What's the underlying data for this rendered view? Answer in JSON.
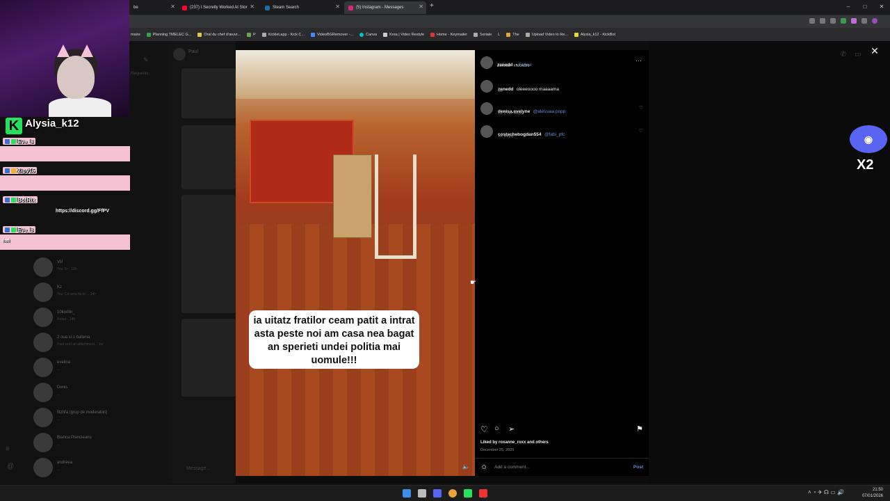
{
  "tabs": [
    {
      "label": "be",
      "color": "#888"
    },
    {
      "label": "(237) I Secretly Worked At Stor",
      "color": "#ff0033"
    },
    {
      "label": "Steam Search",
      "color": "#1b6ea8"
    },
    {
      "label": "(5) Instagram - Messages",
      "color": "#d62976"
    }
  ],
  "bookmarks": [
    {
      "label": "maire",
      "color": "#777"
    },
    {
      "label": "Planning TMELEC G...",
      "color": "#2ea44f"
    },
    {
      "label": "Oral du chef d'œuvr...",
      "color": "#e8c547"
    },
    {
      "label": "P",
      "color": "#6aa84f"
    },
    {
      "label": "Kicklet.app - Kick C...",
      "color": "#aaa"
    },
    {
      "label": "VideoBGRemover -...",
      "color": "#3f8cff"
    },
    {
      "label": "Canva",
      "color": "#00c4cc"
    },
    {
      "label": "Krea | Video Restyle",
      "color": "#ccc"
    },
    {
      "label": "Home - Keymailer",
      "color": "#d33"
    },
    {
      "label": "Seriale",
      "color": "#aaa"
    },
    {
      "label": "L",
      "color": "#aaa"
    },
    {
      "label": "The",
      "color": "#e5a43a"
    },
    {
      "label": "Upload Video to Re...",
      "color": "#aaa"
    },
    {
      "label": "Alysia_k12 - KickBot",
      "color": "#e8d83a"
    }
  ],
  "streamer": {
    "name": "Alysia_k12",
    "badge": "K"
  },
  "chat": [
    {
      "user": "Eve_8",
      "text": ""
    },
    {
      "user": "Zipy15",
      "text": ""
    },
    {
      "user": "BotRix",
      "text": "https://discord.gg/FfPV"
    },
    {
      "user": "Eve_8",
      "text": "hei"
    }
  ],
  "dm": {
    "header_name": "Paul",
    "requests_label": "Requests",
    "message_placeholder": "Message...",
    "conversations": [
      {
        "name": "Vlil",
        "preview": "You: Fr · 10h"
      },
      {
        "name": "Kz",
        "preview": "You: Ce ama facio ... 14h"
      },
      {
        "name": "10korilin_",
        "preview": "Rotea · 14h"
      },
      {
        "name": "2 oua si o balama",
        "preview": "Paul sent an attachment. · 1w"
      },
      {
        "name": "evelina",
        "preview": "..."
      },
      {
        "name": "Denis",
        "preview": "..."
      },
      {
        "name": "fitzhfa (grup de moderatori)",
        "preview": "..."
      },
      {
        "name": "Bianca Plancieanu",
        "preview": "..."
      },
      {
        "name": "andreea",
        "preview": "..."
      }
    ]
  },
  "post": {
    "author": "zenedd",
    "follow": "Follow",
    "subtitle": "Zenedd · FARAON",
    "caption": "ia uitatz fratilor ceam patit a intrat asta peste noi am casa nea bagat an sperieti undei politia mai uomule!!!",
    "comments": [
      {
        "user": "zenedd",
        "text": "oleeeoooo maaaama",
        "meta": "1w"
      },
      {
        "user": "denisa.evelyne",
        "text": "@alessiaa.popp",
        "meta": "1w  1 like  Reply"
      },
      {
        "user": "costachebogdan554",
        "text": "@fabi_pfc",
        "meta": "1w  Reply"
      }
    ],
    "liked_by": "Liked by roxanne_roxx and others",
    "date": "December 25, 2025",
    "add_comment": "Add a comment...",
    "post_button": "Post"
  },
  "overlay": {
    "discord_label": "X2"
  },
  "clock": {
    "time": "21:50",
    "date": "07/01/2026"
  }
}
